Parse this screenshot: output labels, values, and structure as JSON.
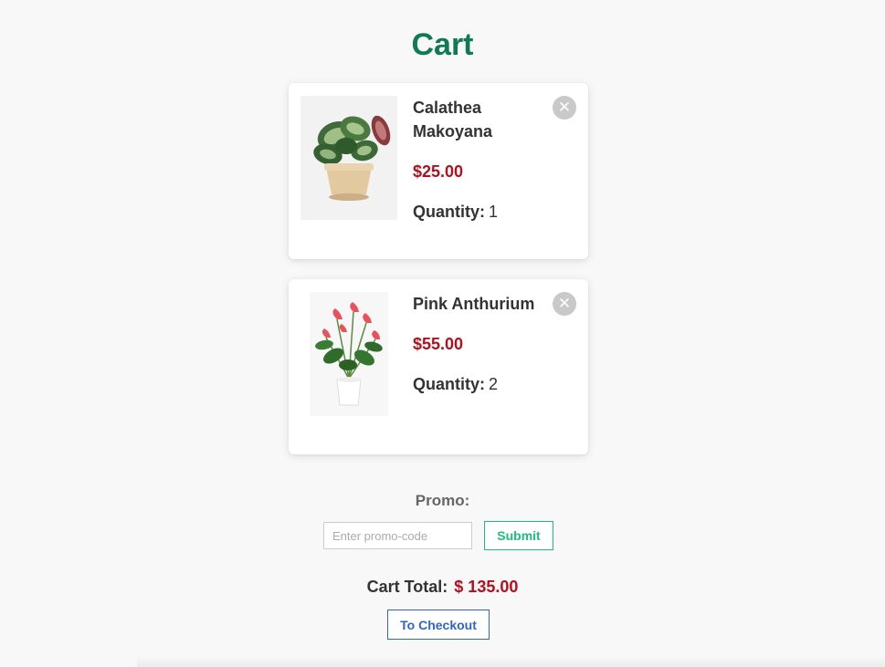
{
  "page": {
    "title": "Cart"
  },
  "cart": {
    "items": [
      {
        "name": "Calathea Makoyana",
        "price": "$25.00",
        "quantity_label": "Quantity:",
        "quantity": "1",
        "remove_symbol": "✕",
        "image_icon": "calathea-plant-image"
      },
      {
        "name": "Pink Anthurium",
        "price": "$55.00",
        "quantity_label": "Quantity:",
        "quantity": "2",
        "remove_symbol": "✕",
        "image_icon": "anthurium-plant-image"
      }
    ]
  },
  "promo": {
    "label": "Promo:",
    "placeholder": "Enter promo-code",
    "value": "",
    "submit_label": "Submit"
  },
  "total": {
    "label": "Cart Total:",
    "amount": "$ 135.00"
  },
  "checkout": {
    "label": "To Checkout"
  },
  "colors": {
    "title": "#0f7a54",
    "price": "#b3101d",
    "submit": "#1bbf7f",
    "checkout": "#2f66c4",
    "remove": "#c9c9c9"
  }
}
